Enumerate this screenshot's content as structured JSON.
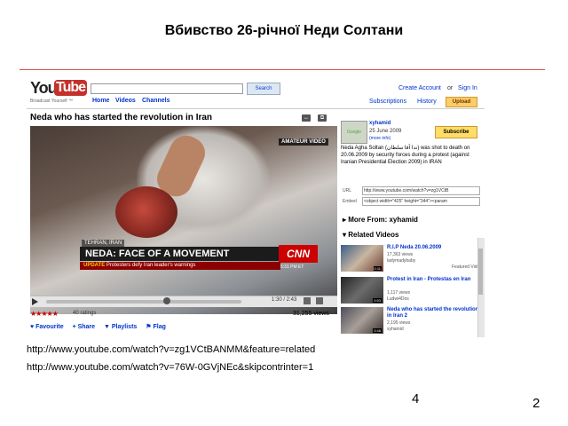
{
  "slide": {
    "title": "Вбивство 26-річної Неди Солтани",
    "link1": "http://www.youtube.com/watch?v=zg1VCtBANMM&feature=related",
    "link2": "http://www.youtube.com/watch?v=76W-0GVjNEc&skipcontrinter=1",
    "slide_number": "4",
    "page_number": "2"
  },
  "youtube": {
    "logo_left": "You",
    "logo_right": "Tube",
    "tagline": "Broadcast Yourself ™",
    "search_button": "Search",
    "nav": [
      "Home",
      "Videos",
      "Channels"
    ],
    "create_account": "Create Account",
    "or": "or",
    "sign_in": "Sign In",
    "subscriptions": "Subscriptions",
    "history": "History",
    "upload": "Upload",
    "video_title": "Neda who has started the revolution in Iran",
    "video": {
      "amateur_label": "AMATEUR VIDEO",
      "location": "TEHRAN, IRAN",
      "headline": "NEDA: FACE OF A MOVEMENT",
      "ticker_tag": "UPDATE",
      "ticker_text": "Protesters defy Iran leader's warnings",
      "network": "CNN",
      "timestamp": "5:31 PM ET",
      "time": "1:30 / 2:43"
    },
    "ratings_stars": "★★★★★",
    "ratings": "40 ratings",
    "views": "31,255 views",
    "actions": [
      "♥ Favourite",
      "+ Share",
      "▼ Playlists",
      "⚑ Flag"
    ],
    "uploader": {
      "avatar_text": "Google",
      "name": "xyhamid",
      "date": "25 June 2009",
      "more_info": "(more info)",
      "subscribe": "Subscribe",
      "description": "Neda Agha Soltan (ندا آقا سلطان) was shot to death on 20.06.2009 by security forces during a protest (against Iranian Presidential Election 2009) in IRAN"
    },
    "url_label": "URL",
    "url_value": "http://www.youtube.com/watch?v=zg1VCtB",
    "embed_label": "Embed",
    "embed_value": "<object width=\"425\" height=\"344\"><param",
    "more_from": "More From: xyhamid",
    "related_header": "Related Videos",
    "related": [
      {
        "title": "R.I.P Neda 20.06.2009",
        "views": "17,363 views",
        "user": "ladymadybaby",
        "featured": "Featured Video",
        "duration": "0:11"
      },
      {
        "title": "Protest in Iran - Protestas en Iran",
        "views": "1,117 views",
        "user": "Ludwi4Dos",
        "featured": "",
        "duration": "0:53"
      },
      {
        "title": "Neda who has started the revolution in Iran 2",
        "views": "2,195 views",
        "user": "xyhamid",
        "featured": "",
        "duration": "0:48"
      }
    ]
  }
}
